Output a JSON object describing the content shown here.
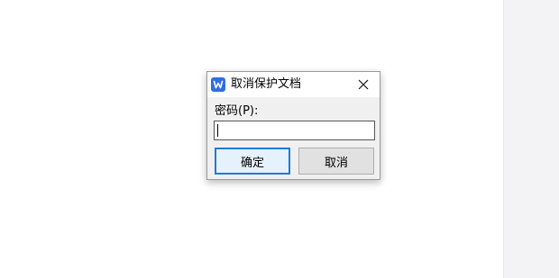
{
  "dialog": {
    "title": "取消保护文档",
    "app_icon": "wps-writer-icon",
    "password_label": "密码(P):",
    "password_value": "",
    "ok_label": "确定",
    "cancel_label": "取消"
  },
  "colors": {
    "accent": "#1e7bd8",
    "app_icon_bg": "#2f6fe4",
    "dialog_bg": "#f0f0f0"
  }
}
